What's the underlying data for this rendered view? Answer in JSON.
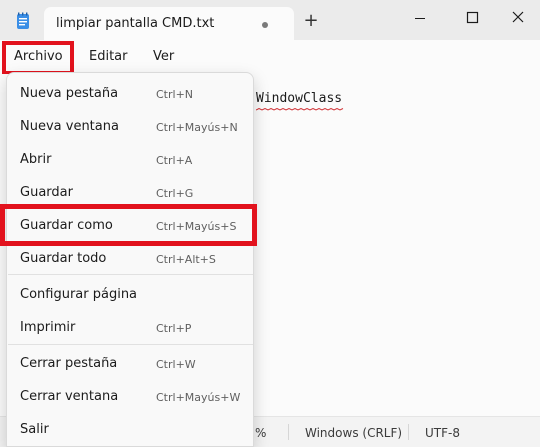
{
  "titlebar": {
    "tab_title": "limpiar pantalla CMD.txt",
    "new_tab_symbol": "+"
  },
  "menubar": {
    "items": [
      "Archivo",
      "Editar",
      "Ver"
    ]
  },
  "editor": {
    "visible_text": "WindowClass"
  },
  "status": {
    "zoom": "%",
    "line_ending": "Windows (CRLF)",
    "encoding": "UTF-8"
  },
  "file_menu": {
    "items": [
      {
        "label": "Nueva pestaña",
        "shortcut": "Ctrl+N"
      },
      {
        "label": "Nueva ventana",
        "shortcut": "Ctrl+Mayús+N"
      },
      {
        "label": "Abrir",
        "shortcut": "Ctrl+A"
      },
      {
        "label": "Guardar",
        "shortcut": "Ctrl+G"
      },
      {
        "label": "Guardar como",
        "shortcut": "Ctrl+Mayús+S"
      },
      {
        "label": "Guardar todo",
        "shortcut": "Ctrl+Alt+S"
      },
      {
        "label": "Configurar página",
        "shortcut": ""
      },
      {
        "label": "Imprimir",
        "shortcut": "Ctrl+P"
      },
      {
        "label": "Cerrar pestaña",
        "shortcut": "Ctrl+W"
      },
      {
        "label": "Cerrar ventana",
        "shortcut": "Ctrl+Mayús+W"
      },
      {
        "label": "Salir",
        "shortcut": ""
      }
    ]
  },
  "colors": {
    "highlight": "#e2121d",
    "spellcheck": "#d13438"
  }
}
